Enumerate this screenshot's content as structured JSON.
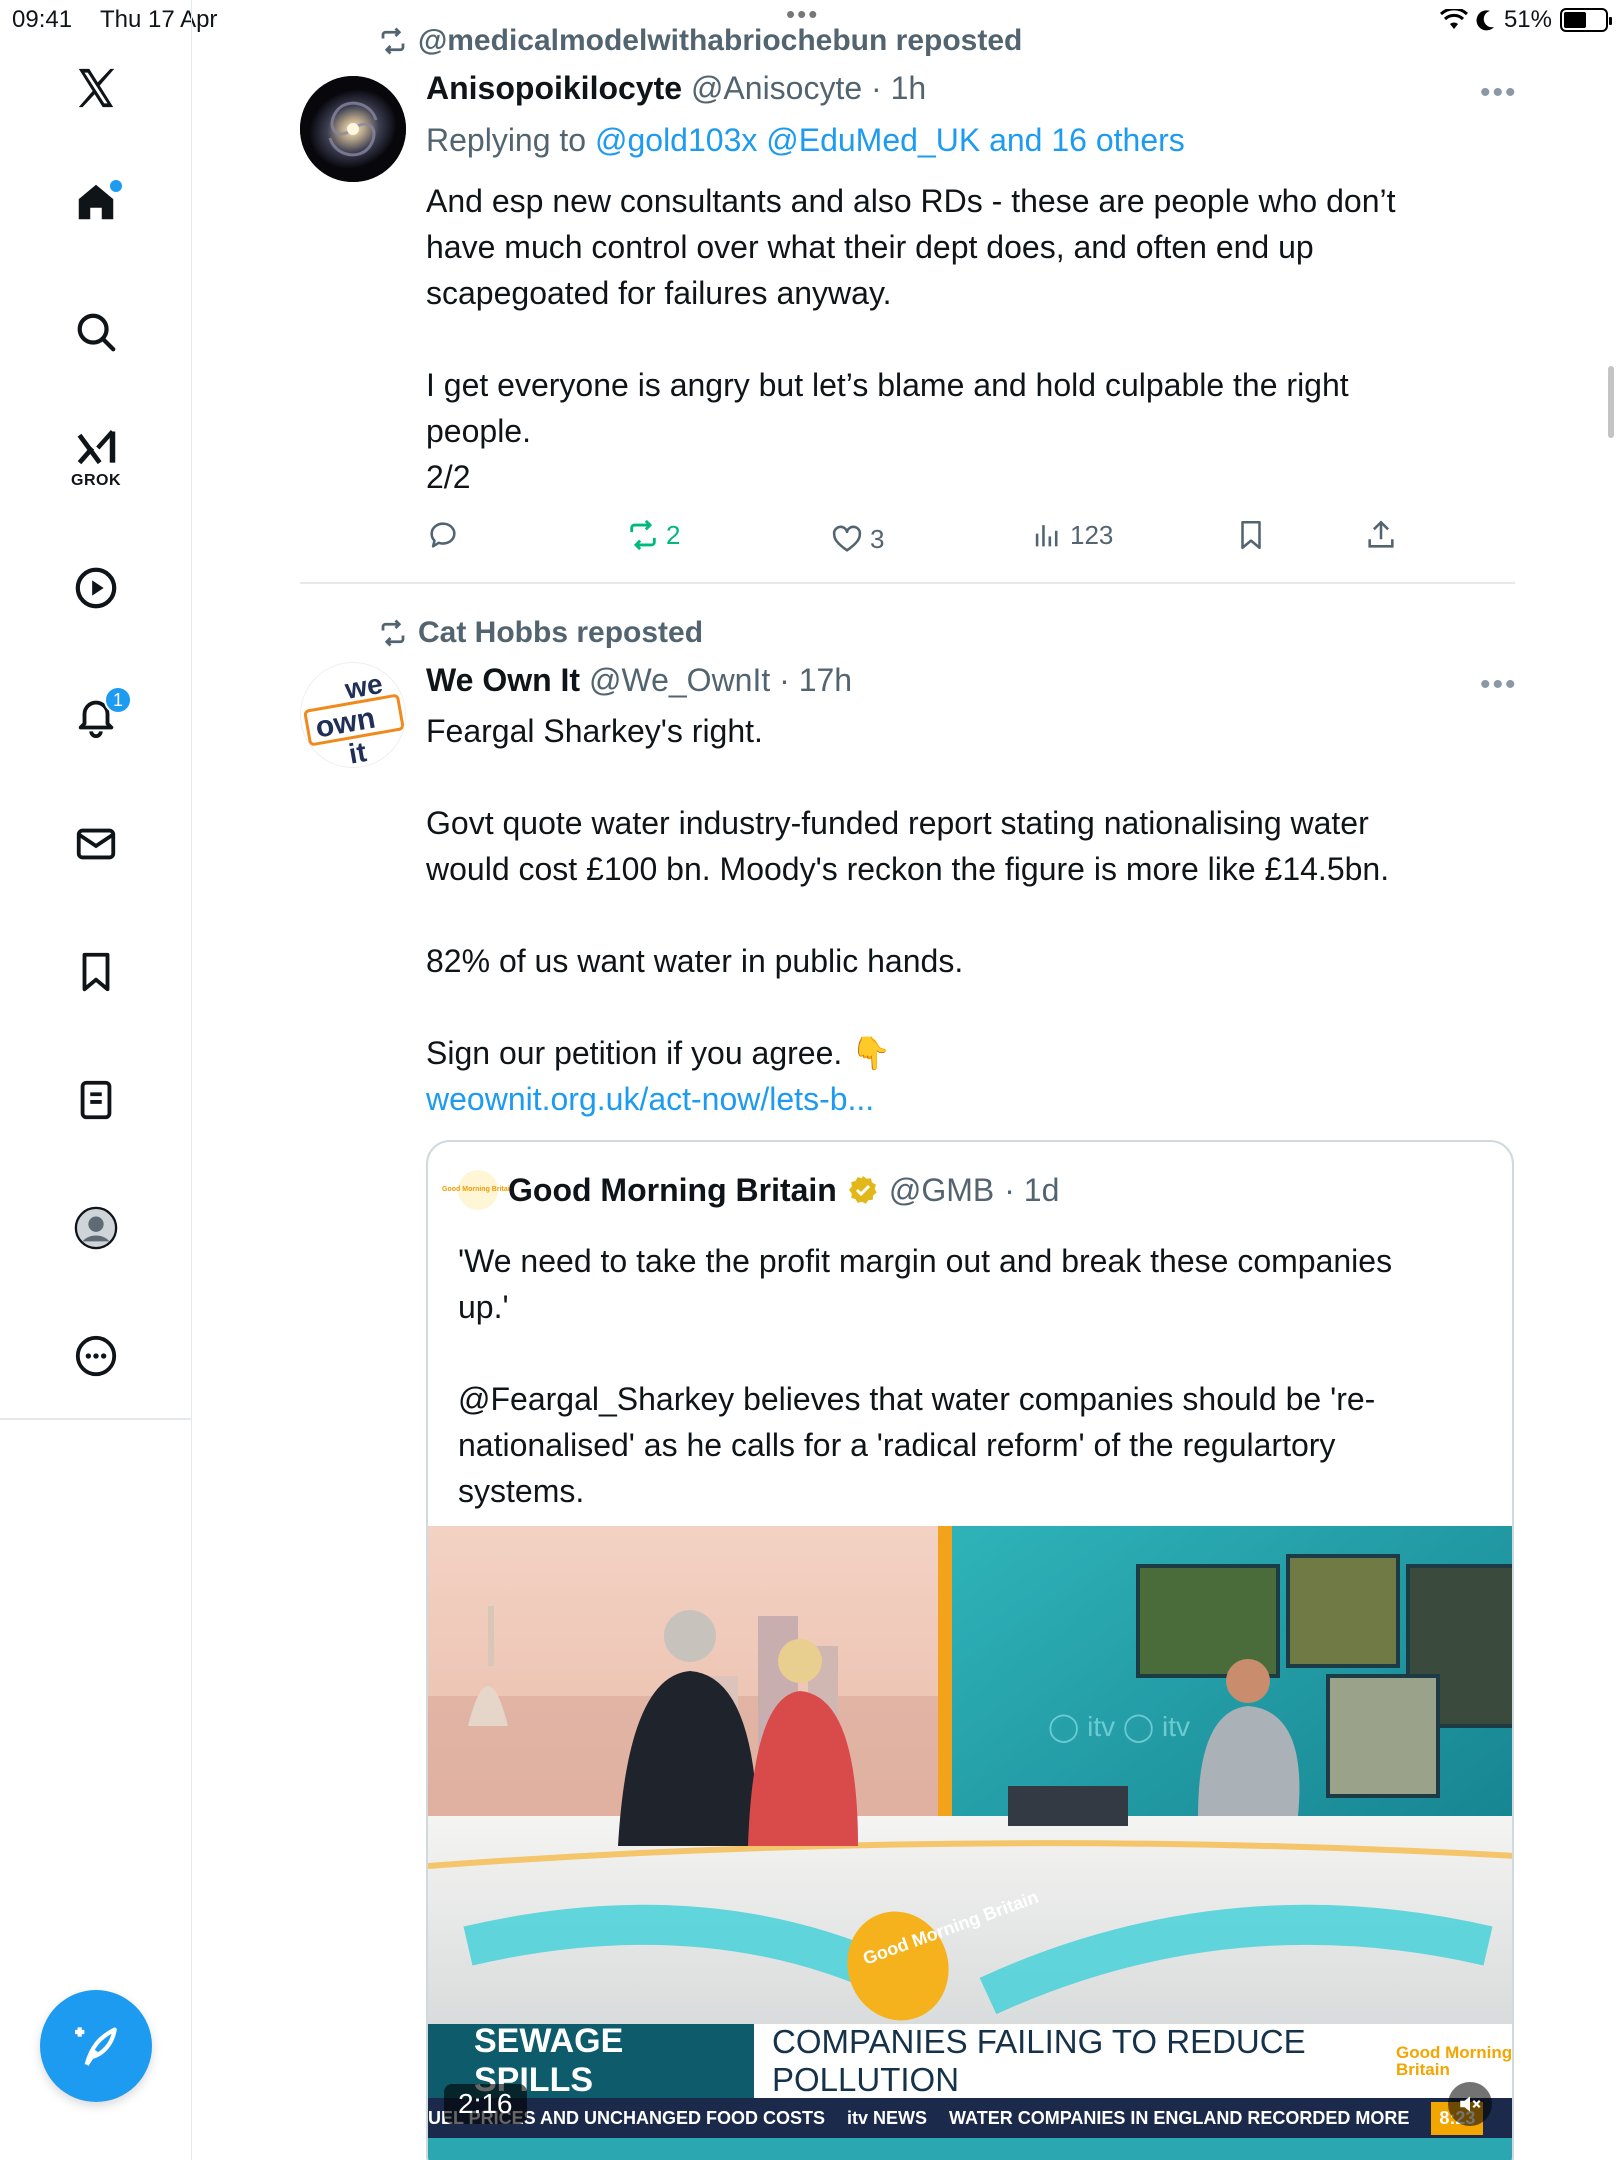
{
  "status_bar": {
    "time": "09:41",
    "date": "Thu 17 Apr",
    "battery": "51%"
  },
  "sidebar": {
    "logo": "x-logo-icon",
    "items": [
      {
        "icon": "home-icon"
      },
      {
        "icon": "search-icon"
      },
      {
        "icon": "grok-icon",
        "label": "GROK"
      },
      {
        "icon": "video-play-icon"
      },
      {
        "icon": "bell-icon",
        "badge": "1"
      },
      {
        "icon": "mail-icon"
      },
      {
        "icon": "bookmark-icon"
      },
      {
        "icon": "lists-icon"
      },
      {
        "icon": "profile-icon"
      },
      {
        "icon": "more-circle-icon"
      }
    ],
    "compose_icon": "compose-feather-icon"
  },
  "posts": [
    {
      "repost_by": "@medicalmodelwithabriochebun reposted",
      "name": "Anisopoikilocyte",
      "handle": "@Anisocyte",
      "time": "· 1h",
      "replying_prefix": "Replying to ",
      "replying_to": "@gold103x @EduMed_UK and 16 others",
      "text_lines": [
        "And esp new consultants and also RDs - these are people who don’t",
        "have much control over what their dept does, and often end up",
        "scapegoated for failures anyway.",
        "",
        "I get everyone is angry but let’s blame and hold culpable the right",
        "people.",
        "2/2"
      ],
      "actions": {
        "replies": "",
        "reposts": "2",
        "likes": "3",
        "views": "123"
      }
    },
    {
      "repost_by": "Cat Hobbs reposted",
      "name": "We Own It",
      "handle": "@We_OwnIt",
      "time": "· 17h",
      "avatar_text": [
        "we",
        "own",
        "it"
      ],
      "text_lines": [
        "Feargal Sharkey's right.",
        "",
        "Govt quote water industry-funded report stating nationalising water",
        "would cost £100 bn. Moody's reckon the figure is more like £14.5bn.",
        "",
        "82% of us want water in public hands.",
        "",
        "Sign our petition if you agree. 👇"
      ],
      "link": "weownit.org.uk/act-now/lets-b...",
      "quote": {
        "logo_text": "Good Morning Britain",
        "name": "Good Morning Britain",
        "handle": "@GMB",
        "time": "· 1d",
        "text_lines": [
          "'We need to take the profit margin out and break these companies",
          "up.'",
          "",
          "@Feargal_Sharkey believes that water companies should be 're-",
          "nationalised' as he calls for a 'radical reform' of the regulartory",
          "systems."
        ],
        "video": {
          "studio_logo": "Good Morning Britain",
          "headline_left": "SEWAGE SPILLS",
          "headline_right": "COMPANIES FAILING TO REDUCE POLLUTION",
          "gmb_badge": "Good Morning Britain",
          "ticker_left": "UEL PRICES AND UNCHANGED FOOD COSTS",
          "ticker_brand": "itv NEWS",
          "ticker_right": "WATER COMPANIES IN ENGLAND RECORDED MORE",
          "clock": "8:23",
          "duration": "2:16"
        }
      }
    }
  ]
}
